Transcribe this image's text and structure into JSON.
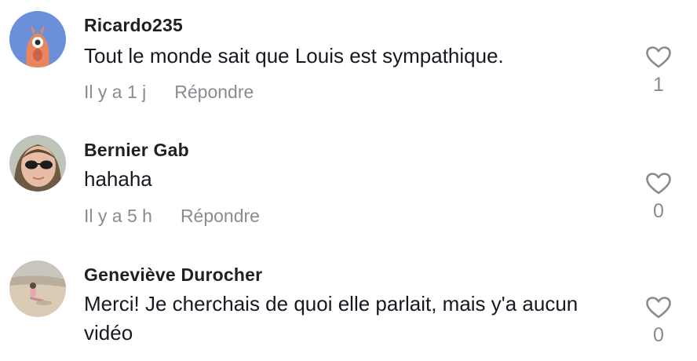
{
  "comments": [
    {
      "username": "Ricardo235",
      "text": "Tout le monde sait que Louis est sympathique.",
      "time": "Il y a 1 j",
      "reply_label": "Répondre",
      "likes": "1",
      "avatar_icon": "orange-monster-avatar",
      "avatar_color": "#6b8fd8"
    },
    {
      "username": "Bernier Gab",
      "text": "hahaha",
      "time": "Il y a 5 h",
      "reply_label": "Répondre",
      "likes": "0",
      "avatar_icon": "person-sunglasses-avatar"
    },
    {
      "username": "Geneviève Durocher",
      "text": "Merci! Je cherchais de quoi elle parlait, mais y'a aucun vidéo",
      "time": "",
      "reply_label": "",
      "likes": "0",
      "avatar_icon": "beach-photo-avatar"
    }
  ],
  "icons": {
    "like": "heart-outline-icon"
  },
  "colors": {
    "secondary_text": "#8a8b91",
    "primary_text": "#161823"
  }
}
